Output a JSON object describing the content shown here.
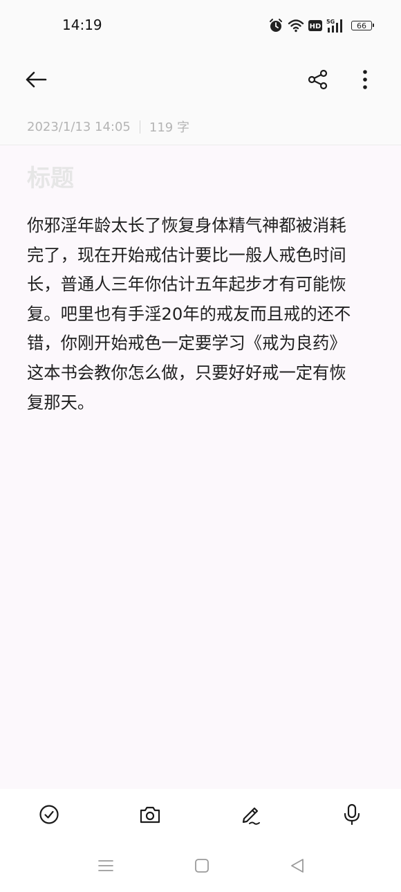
{
  "status_bar": {
    "time": "14:19",
    "network": "5G",
    "hd": "HD",
    "battery": "66",
    "icons": [
      "alarm-icon",
      "wifi-icon",
      "hd-icon",
      "signal-5g-icon",
      "battery-icon"
    ]
  },
  "toolbar": {
    "icons": [
      "back-arrow-icon",
      "share-icon",
      "more-vertical-icon"
    ]
  },
  "note": {
    "date": "2023/1/13 14:05",
    "char_count": "119 字",
    "title_placeholder": "标题",
    "body": "你邪淫年龄太长了恢复身体精气神都被消耗\n完了，现在开始戒估计要比一般人戒色时间\n长，普通人三年你估计五年起步才有可能恢\n复。吧里也有手淫20年的戒友而且戒的还不\n错，你刚开始戒色一定要学习《戒为良药》\n这本书会教你怎么做，只要好好戒一定有恢\n复那天。"
  },
  "bottom_toolbar": {
    "icons": [
      "checklist-icon",
      "camera-icon",
      "handwriting-pen-icon",
      "microphone-icon"
    ]
  },
  "nav_bar": {
    "icons": [
      "menu-nav-icon",
      "home-nav-icon",
      "back-nav-icon"
    ]
  },
  "colors": {
    "background": "#fcf8fc",
    "header_background": "#fafafa",
    "text": "#202020",
    "meta_text": "#b4b4b4",
    "placeholder": "#e6e6e6"
  }
}
